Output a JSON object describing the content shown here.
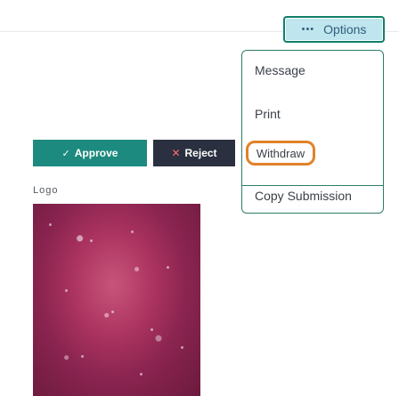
{
  "options": {
    "label": "Options",
    "icon": "more-horizontal-icon"
  },
  "menu": {
    "items": [
      {
        "label": "Message"
      },
      {
        "label": "Print"
      },
      {
        "label": "Withdraw"
      },
      {
        "label": "Copy Submission"
      }
    ]
  },
  "actions": {
    "approve_label": "Approve",
    "reject_label": "Reject",
    "approve_icon": "check-icon",
    "reject_icon": "x-icon"
  },
  "logo": {
    "label": "Logo"
  },
  "colors": {
    "accent": "#1c8a7e",
    "reject": "#2b3040",
    "highlight_ring": "#e0822a",
    "options_bg": "#bfe5ef"
  }
}
